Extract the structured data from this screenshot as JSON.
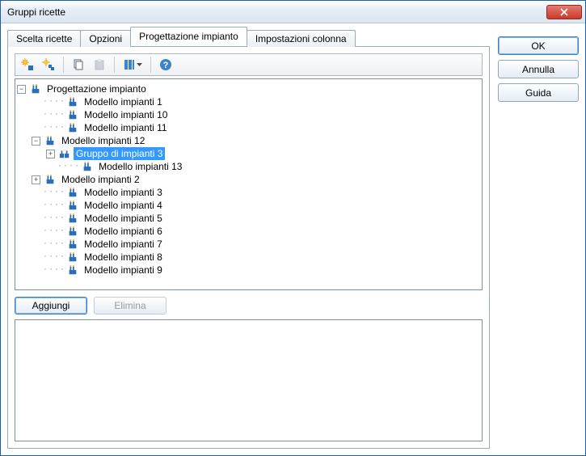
{
  "window": {
    "title": "Gruppi ricette"
  },
  "tabs": {
    "recipe_choice": "Scelta ricette",
    "options": "Opzioni",
    "plant_design": "Progettazione impianto",
    "column_settings": "Impostazioni colonna",
    "active": "plant_design"
  },
  "side_buttons": {
    "ok": "OK",
    "cancel": "Annulla",
    "help": "Guida"
  },
  "toolbar": {
    "new_sun_icon": "new-item-icon",
    "new_sun2_icon": "new-subitem-icon",
    "copy_icon": "copy-icon",
    "paste_icon": "paste-icon",
    "columns_icon": "columns-icon",
    "help_icon": "help-icon"
  },
  "tree": {
    "root": {
      "label": "Progettazione impianto",
      "toggle": "−",
      "children": [
        {
          "label": "Modello impianti 1",
          "toggle": ""
        },
        {
          "label": "Modello impianti 10",
          "toggle": ""
        },
        {
          "label": "Modello impianti 11",
          "toggle": ""
        },
        {
          "label": "Modello impianti 12",
          "toggle": "−",
          "children": [
            {
              "label": "Gruppo di impianti 3",
              "toggle": "+",
              "selected": true,
              "groupIcon": true
            },
            {
              "label": "Modello impianti 13",
              "toggle": ""
            }
          ]
        },
        {
          "label": "Modello impianti 2",
          "toggle": "+"
        },
        {
          "label": "Modello impianti 3",
          "toggle": ""
        },
        {
          "label": "Modello impianti 4",
          "toggle": ""
        },
        {
          "label": "Modello impianti 5",
          "toggle": ""
        },
        {
          "label": "Modello impianti 6",
          "toggle": ""
        },
        {
          "label": "Modello impianti 7",
          "toggle": ""
        },
        {
          "label": "Modello impianti 8",
          "toggle": ""
        },
        {
          "label": "Modello impianti 9",
          "toggle": ""
        }
      ]
    }
  },
  "panel_buttons": {
    "add": "Aggiungi",
    "delete": "Elimina"
  }
}
